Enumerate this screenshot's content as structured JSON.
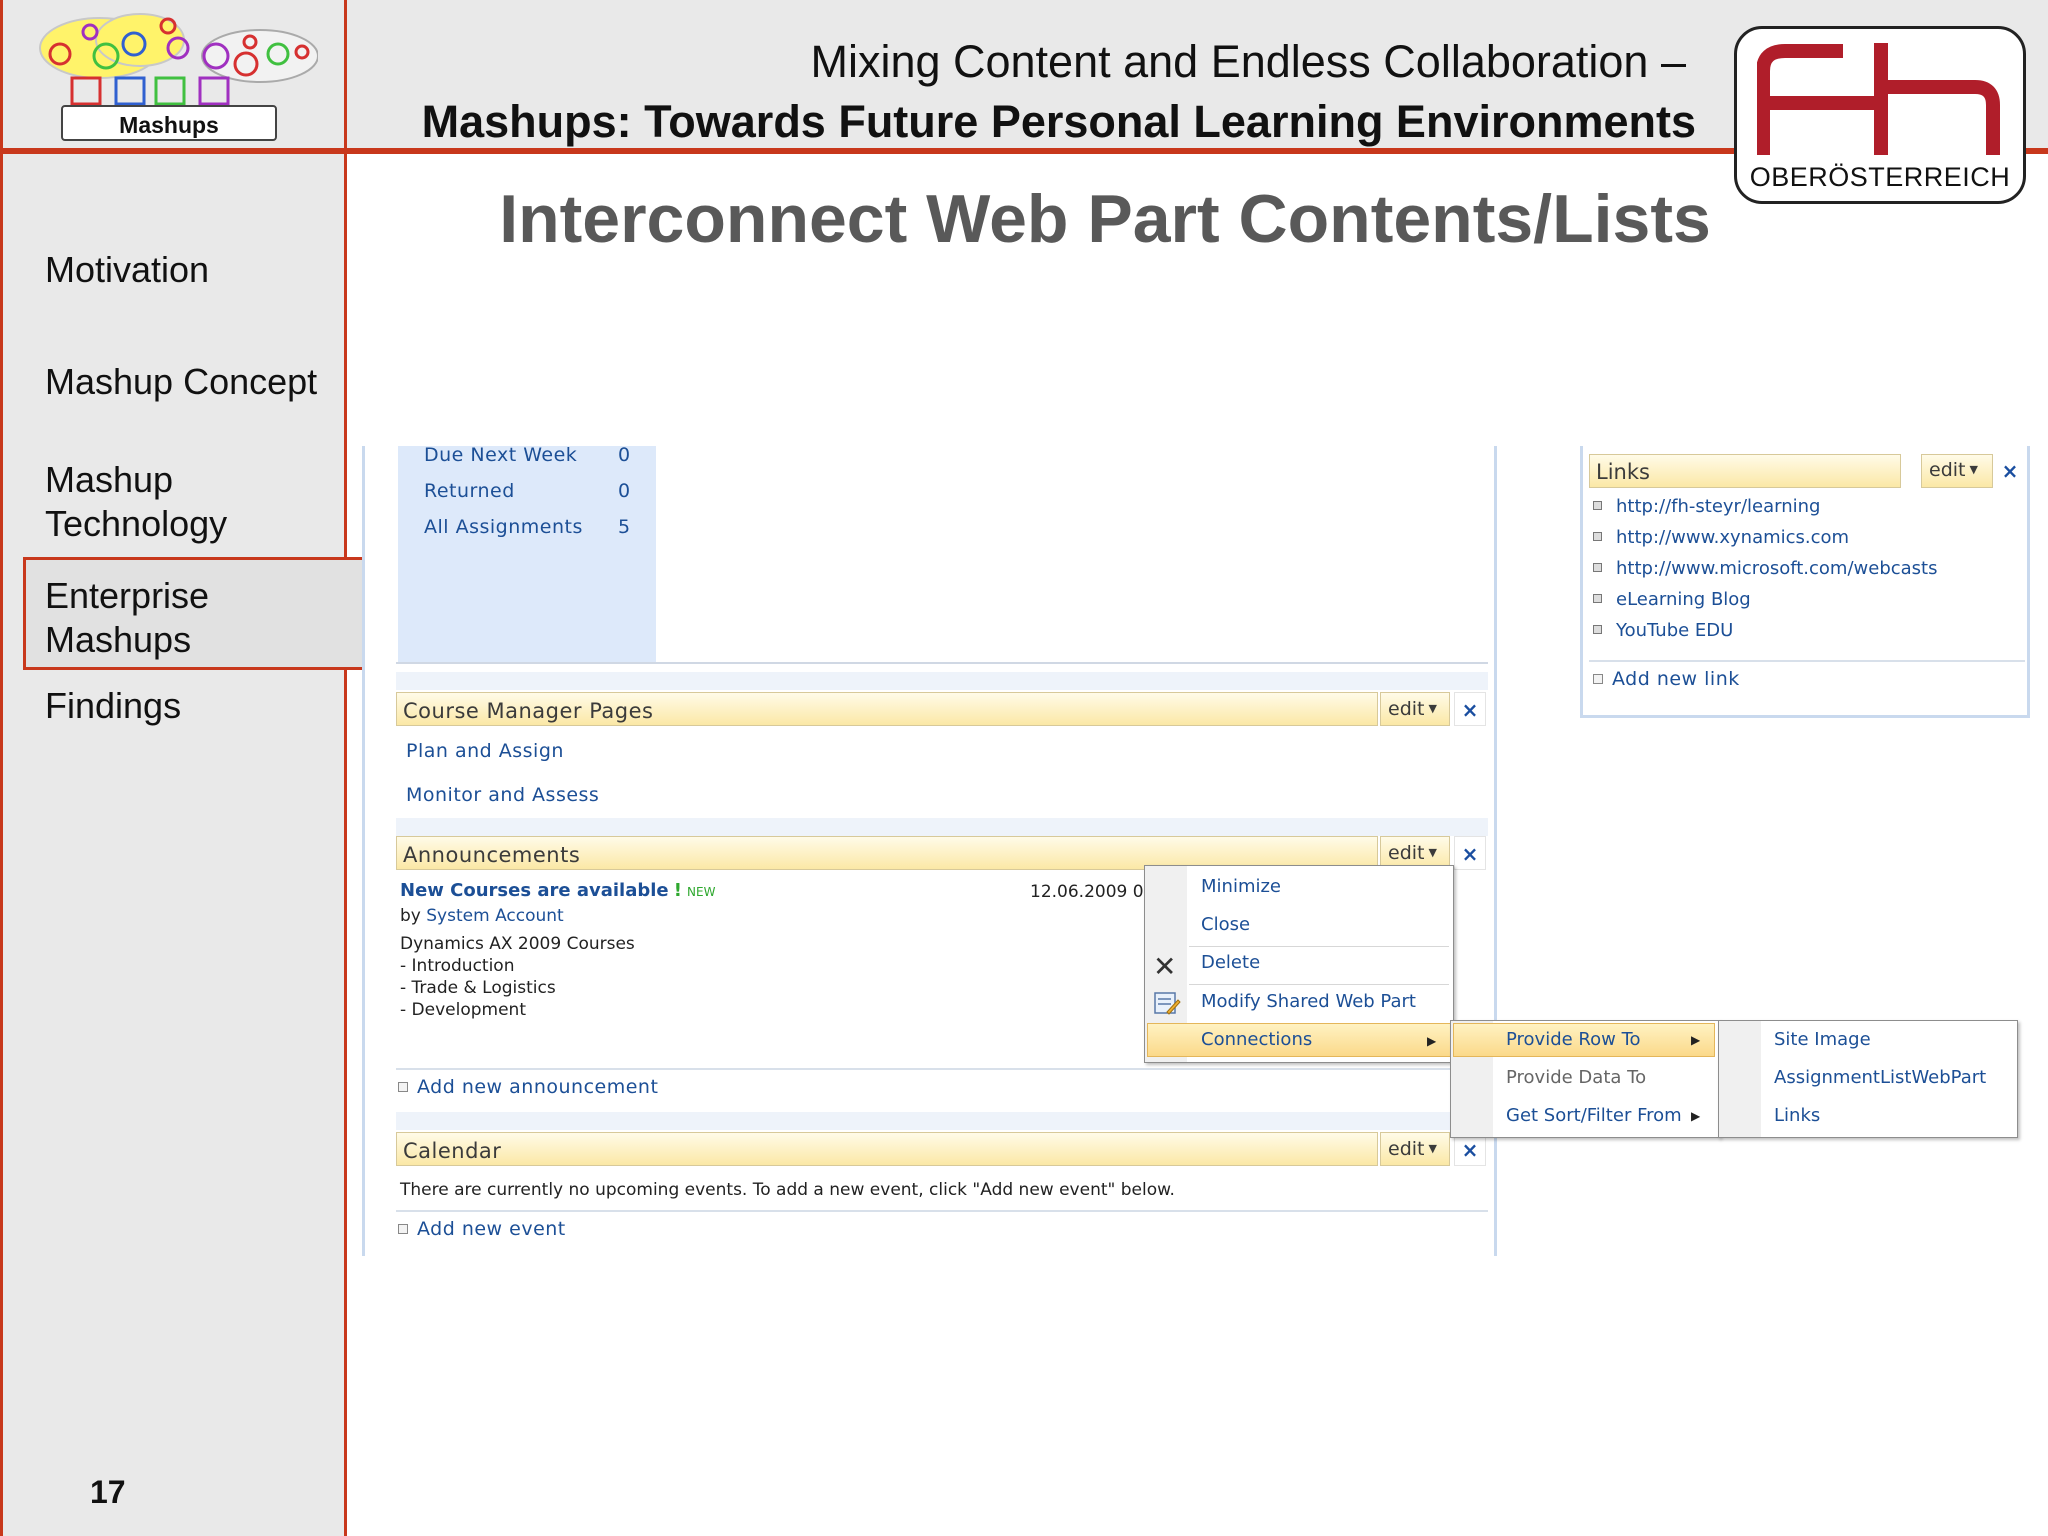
{
  "header": {
    "logo_label": "Mashups",
    "title_line1": "Mixing Content and Endless Collaboration –",
    "title_line2": "Mashups: Towards Future Personal Learning Environments",
    "fh_logo_text": "fh",
    "fh_logo_caption": "OBERÖSTERREICH"
  },
  "slide": {
    "title": "Interconnect Web Part Contents/Lists",
    "page_number": "17"
  },
  "sidebar": {
    "items": [
      {
        "label": "Motivation"
      },
      {
        "label": "Mashup Concept"
      },
      {
        "label": "Mashup",
        "label2": "Technology"
      },
      {
        "label": "Enterprise",
        "label2": "Mashups",
        "selected": true
      },
      {
        "label": "Findings"
      }
    ]
  },
  "sharepoint": {
    "assignments": [
      {
        "label": "Due Next Week",
        "value": "0"
      },
      {
        "label": "Returned",
        "value": "0"
      },
      {
        "label": "All Assignments",
        "value": "5"
      }
    ],
    "edit_label": "edit",
    "close_glyph": "×",
    "course_manager": {
      "title": "Course Manager Pages",
      "links": [
        "Plan and Assign",
        "Monitor and Assess"
      ]
    },
    "announcements": {
      "title": "Announcements",
      "item_title": "New Courses are available",
      "new_badge": "NEW",
      "date": "12.06.2009 0",
      "by_prefix": "by ",
      "author": "System Account",
      "body": [
        "Dynamics AX 2009 Courses",
        "- Introduction",
        "- Trade & Logistics",
        "- Development"
      ],
      "add_label": "Add new announcement"
    },
    "calendar": {
      "title": "Calendar",
      "empty_text": "There are currently no upcoming events. To add a new event, click \"Add new event\" below.",
      "add_label": "Add new event"
    },
    "links": {
      "title": "Links",
      "items": [
        "http://fh-steyr/learning",
        "http://www.xynamics.com",
        "http://www.microsoft.com/webcasts",
        "eLearning Blog",
        "YouTube EDU"
      ],
      "add_label": "Add new link"
    },
    "context_menu": {
      "items": [
        "Minimize",
        "Close",
        "Delete",
        "Modify Shared Web Part",
        "Connections"
      ],
      "submenu": [
        "Provide Row To",
        "Provide Data To",
        "Get Sort/Filter From"
      ],
      "submenu2": [
        "Site Image",
        "AssignmentListWebPart",
        "Links"
      ]
    }
  },
  "colors": {
    "accent": "#c8381c",
    "link": "#1c4f96",
    "title_gray": "#595959"
  }
}
